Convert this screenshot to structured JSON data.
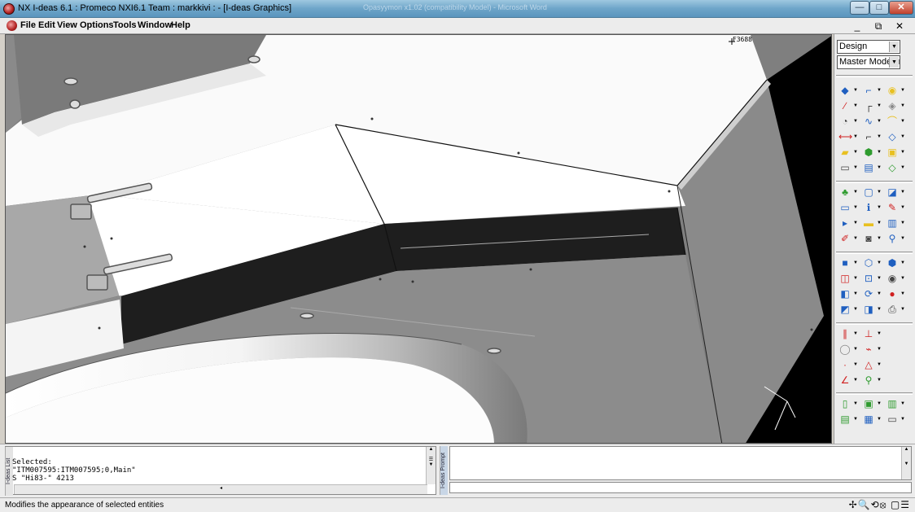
{
  "window": {
    "title": "NX I-deas 6.1 :    Promeco NXI6.1 Team : markkivi :  - [I-deas Graphics]",
    "background_title": "Opasyymon x1.02 (compatibility Model) - Microsoft Word",
    "min_label": "—",
    "max_label": "□",
    "close_label": "✕"
  },
  "menu": {
    "items": [
      "File",
      "Edit",
      "View",
      "Options",
      "Tools",
      "Window",
      "Help"
    ],
    "mdi_min": "_",
    "mdi_restore": "⧉",
    "mdi_close": "✕"
  },
  "viewport": {
    "id_label": "F3688"
  },
  "panel": {
    "task": "Design",
    "application": "Master Modeler",
    "colors": {
      "tool_blue": "#1f5fc0",
      "tool_green": "#2e9b2e",
      "tool_yellow": "#e8c020",
      "tool_red": "#d02020"
    },
    "tools": [
      "part-icon",
      "sketch-icon",
      "shell-icon",
      "line-icon",
      "fillet-curve-icon",
      "surface-icon",
      "circle-icon",
      "spline-icon",
      "sweep-icon",
      "dimension-icon",
      "corner-icon",
      "loft-icon",
      "extrude-icon",
      "revolve-icon",
      "feature-icon",
      "rectangle-icon",
      "pattern-icon",
      "boolean-icon",
      "assembly-icon",
      "place-icon",
      "component-icon",
      "frame-icon",
      "info-icon",
      "paint-icon",
      "arrows-icon",
      "measure-icon",
      "database-icon",
      "eraser-icon",
      "window-icon",
      "hierarchy-icon",
      "shade-icon",
      "box-view-icon",
      "iso-view-icon",
      "zoom-icon",
      "fit-icon",
      "eye-icon",
      "front-view-icon",
      "rotate-view-icon",
      "record-icon",
      "top-view-icon",
      "side-view-icon",
      "print-icon",
      "constraint-parallel-icon",
      "constraint-perp-icon",
      "constraint-circle-icon",
      "constraint-tangent-icon",
      "constraint-coincident-icon",
      "constraint-triangle-icon",
      "constraint-angle-icon",
      "constraint-fix-icon",
      "green-part-icon",
      "green-assembly-icon",
      "green-split-icon",
      "green-beam-icon",
      "blue-db-icon",
      "flat-icon"
    ]
  },
  "list_panel": {
    "side_label": "I-deas List",
    "lines": [
      "Selected:",
      "\"ITM007595:ITM007595;0,Main\"",
      "S \"Hi83-\" 4213"
    ]
  },
  "prompt_panel": {
    "side_label": "I-deas Prompt"
  },
  "status": {
    "message": "Modifies the appearance of selected entities",
    "icons": "✢🔍⟲⦻ ▢☰"
  }
}
